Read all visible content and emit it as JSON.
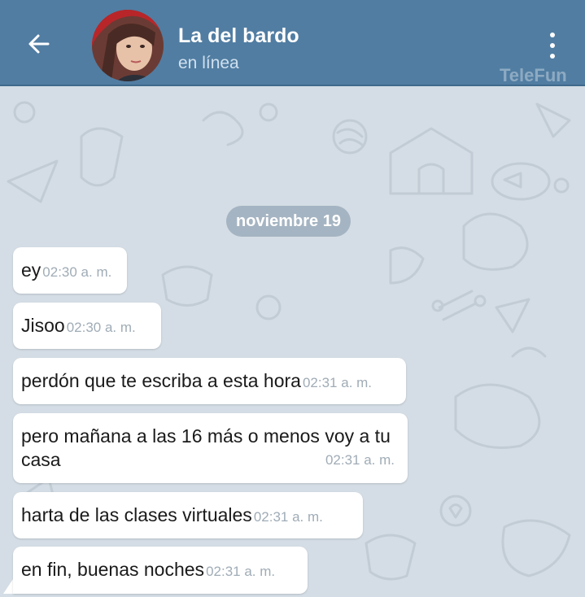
{
  "header": {
    "title": "La del bardo",
    "status": "en línea",
    "watermark": "TeleFun",
    "back_icon": "arrow-left-icon",
    "menu_icon": "more-vertical-icon"
  },
  "chat": {
    "date": "noviembre 19",
    "messages": [
      {
        "text": "ey",
        "time": "02:30 a. m."
      },
      {
        "text": "Jisoo",
        "time": "02:30 a. m."
      },
      {
        "text": "perdón que te escriba a esta hora",
        "time": "02:31 a. m."
      },
      {
        "text": "pero mañana a las 16 más o menos voy a tu casa",
        "time": "02:31 a. m."
      },
      {
        "text": "harta de las clases virtuales",
        "time": "02:31 a. m."
      },
      {
        "text": "en fin, buenas noches",
        "time": "02:31 a. m."
      }
    ]
  },
  "colors": {
    "header": "#517da2",
    "wallpaper": "#d4dde5",
    "bubble": "#ffffff",
    "time": "#a0acb6"
  }
}
